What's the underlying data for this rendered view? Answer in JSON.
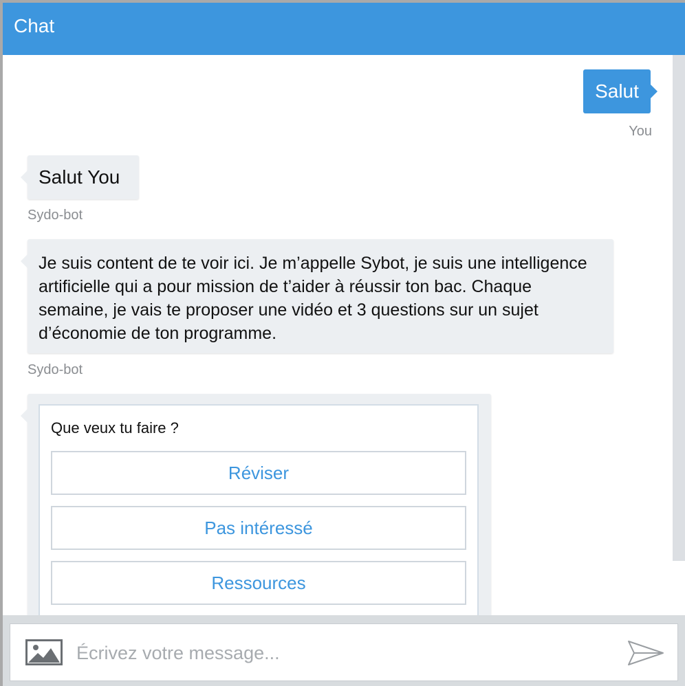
{
  "header": {
    "title": "Chat"
  },
  "messages": [
    {
      "sender": "You",
      "text": "Salut"
    },
    {
      "sender": "Sydo-bot",
      "text": "Salut You"
    },
    {
      "sender": "Sydo-bot",
      "text": "Je suis content de te voir ici. Je m’appelle Sybot, je suis une intelligence artificielle qui a pour mission de t’aider à réussir ton bac. Chaque semaine, je vais te proposer une vidéo et 3 questions sur un sujet d’économie de ton programme."
    },
    {
      "sender": "Sydo-bot",
      "question": "Que veux tu faire ?",
      "options": [
        "Réviser",
        "Pas intéressé",
        "Ressources"
      ]
    }
  ],
  "composer": {
    "placeholder": "Écrivez votre message...",
    "attach_icon": "image-icon",
    "send_icon": "send-icon"
  },
  "colors": {
    "brand_blue": "#3d96de",
    "bot_bubble": "#eceff2",
    "sender_label": "#8a8d91"
  }
}
